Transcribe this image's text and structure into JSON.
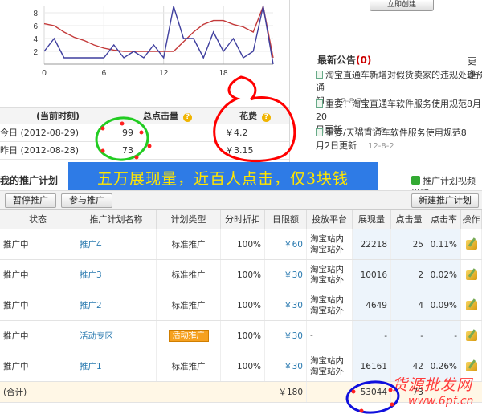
{
  "chart_data": {
    "type": "line",
    "x_ticks": [
      "0",
      "6",
      "12",
      "18"
    ],
    "y_ticks": [
      "8",
      "6",
      "4",
      "2"
    ],
    "ylim": [
      0,
      9
    ],
    "xlim": [
      0,
      23
    ],
    "series": [
      {
        "color": "#c43a3a",
        "values": [
          6.3,
          6.0,
          5.0,
          4.2,
          3.7,
          3.0,
          2.5,
          2.2,
          2.0,
          2.0,
          2.0,
          2.0,
          2.0,
          2.0,
          3.5,
          5.0,
          6.2,
          6.8,
          6.8,
          6.2,
          5.8,
          5.0,
          9.0,
          1.0
        ]
      },
      {
        "color": "#3f3f9e",
        "values": [
          2.0,
          4.0,
          1.0,
          1.0,
          1.0,
          1.0,
          1.0,
          3.0,
          1.0,
          2.0,
          1.0,
          3.0,
          1.0,
          9.0,
          4.0,
          4.0,
          1.0,
          5.0,
          2.0,
          4.0,
          1.0,
          2.0,
          9.0,
          0.0
        ]
      }
    ]
  },
  "top_button": "立即创建",
  "notice": {
    "title": "最新公告",
    "count": "(0)",
    "more": "更多",
    "items": [
      {
        "line1": "淘宝直通车新增对假货卖家的违规处理预通",
        "line2": "知",
        "date": "12-8-24"
      },
      {
        "line1": "重要！淘宝直通车软件服务使用规范8月20",
        "line2": "日更新",
        "date": "12-8-20"
      },
      {
        "line1": "重要/天猫直通车软件服务使用规范8",
        "line2": "月2日更新",
        "date": "12-8-2"
      }
    ]
  },
  "summary": {
    "col_period": "(当前时刻)",
    "col_clicks": "总点击量",
    "col_cost": "花费",
    "rows": [
      {
        "period": "今日 (2012-08-29)",
        "clicks": "99",
        "cost": "￥4.2"
      },
      {
        "period": "昨日 (2012-08-28)",
        "clicks": "73",
        "cost": "￥3.15"
      }
    ]
  },
  "banner": "五万展现量，近百人点击，仅3块钱",
  "plans": {
    "title": "我的推广计划",
    "video_link": "推广计划视频说明",
    "pause_btn": "暂停推广",
    "join_btn": "参与推广",
    "new_btn": "新建推广计划",
    "columns": [
      "状态",
      "推广计划名称",
      "计划类型",
      "分时折扣",
      "日限额",
      "投放平台",
      "展现量",
      "点击量",
      "点击率",
      "操作"
    ],
    "rows": [
      {
        "status": "推广中",
        "name": "推广4",
        "type": "标准推广",
        "discount": "100%",
        "budget": "￥60",
        "platform1": "淘宝站内",
        "platform2": "淘宝站外",
        "impressions": "22218",
        "clicks": "25",
        "ctr": "0.11%"
      },
      {
        "status": "推广中",
        "name": "推广3",
        "type": "标准推广",
        "discount": "100%",
        "budget": "￥30",
        "platform1": "淘宝站内",
        "platform2": "淘宝站外",
        "impressions": "10016",
        "clicks": "2",
        "ctr": "0.02%"
      },
      {
        "status": "推广中",
        "name": "推广2",
        "type": "标准推广",
        "discount": "100%",
        "budget": "￥30",
        "platform1": "淘宝站内",
        "platform2": "淘宝站外",
        "impressions": "4649",
        "clicks": "4",
        "ctr": "0.09%"
      },
      {
        "status": "推广中",
        "name": "活动专区",
        "type": "活动推广",
        "discount": "100%",
        "budget": "￥30",
        "platform1": "-",
        "platform2": "",
        "impressions": "-",
        "clicks": "-",
        "ctr": "-"
      },
      {
        "status": "推广中",
        "name": "推广1",
        "type": "标准推广",
        "discount": "100%",
        "budget": "￥30",
        "platform1": "淘宝站内",
        "platform2": "淘宝站外",
        "impressions": "16161",
        "clicks": "42",
        "ctr": "0.26%"
      }
    ],
    "total": {
      "label": "(合计)",
      "budget": "￥180",
      "impressions": "53044",
      "clicks": "73"
    }
  },
  "watermark": {
    "cn": "货源批发网",
    "url": "www.6pf.cn"
  },
  "annotation_colors": {
    "green": "#22cc22",
    "red": "#ff0000",
    "blue": "#1010dd"
  }
}
